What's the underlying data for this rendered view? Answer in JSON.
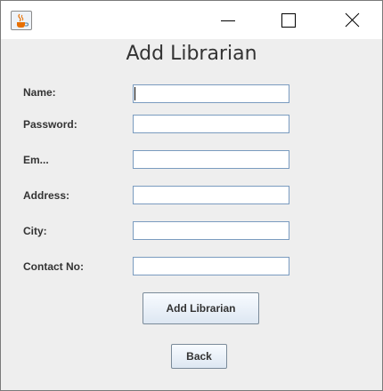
{
  "window": {
    "icon": "java-cup-icon",
    "controls": [
      "minimize-icon",
      "maximize-icon",
      "close-icon"
    ]
  },
  "form": {
    "title": "Add Librarian",
    "fields": [
      {
        "label": "Name:",
        "value": ""
      },
      {
        "label": "Password:",
        "value": ""
      },
      {
        "label": "Em...",
        "value": ""
      },
      {
        "label": "Address:",
        "value": ""
      },
      {
        "label": "City:",
        "value": ""
      },
      {
        "label": "Contact No:",
        "value": ""
      }
    ],
    "submit_label": "Add Librarian",
    "back_label": "Back"
  }
}
